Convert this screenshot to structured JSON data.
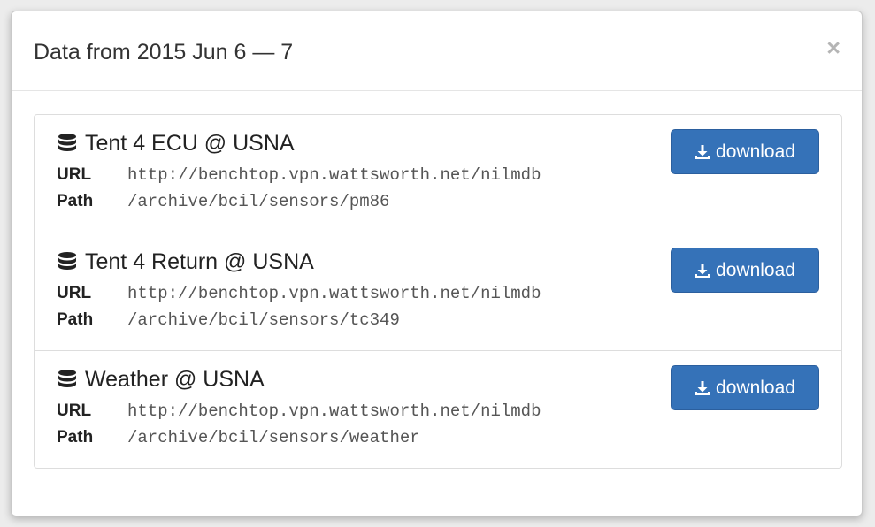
{
  "modal": {
    "title": "Data from 2015 Jun 6 — 7",
    "close_label": "×"
  },
  "labels": {
    "url": "URL",
    "path": "Path"
  },
  "datasets": [
    {
      "name": "Tent 4 ECU @ USNA",
      "url": "http://benchtop.vpn.wattsworth.net/nilmdb",
      "path": "/archive/bcil/sensors/pm86",
      "button_label": "download",
      "icon": "database-icon"
    },
    {
      "name": "Tent 4 Return @ USNA",
      "url": "http://benchtop.vpn.wattsworth.net/nilmdb",
      "path": "/archive/bcil/sensors/tc349",
      "button_label": "download",
      "icon": "database-icon"
    },
    {
      "name": "Weather @ USNA",
      "url": "http://benchtop.vpn.wattsworth.net/nilmdb",
      "path": "/archive/bcil/sensors/weather",
      "button_label": "download",
      "icon": "database-icon"
    }
  ],
  "colors": {
    "primary_button": "#3572b8",
    "title_text": "#333333",
    "code_text": "#555555"
  }
}
